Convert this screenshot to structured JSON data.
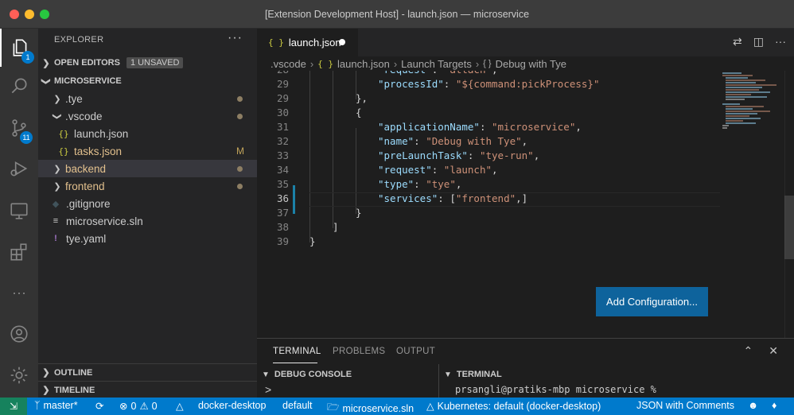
{
  "window": {
    "title": "[Extension Development Host] - launch.json — microservice"
  },
  "activity_bar": {
    "explorer_badge": "1",
    "scm_badge": "11",
    "more": "···"
  },
  "sidebar": {
    "title": "EXPLORER",
    "more": "···",
    "open_editors": {
      "label": "OPEN EDITORS",
      "badge": "1 UNSAVED"
    },
    "folder": {
      "label": "MICROSERVICE"
    },
    "items": [
      {
        "label": ".tye",
        "icon": "chevron-right"
      },
      {
        "label": ".vscode",
        "icon": "chevron-down"
      },
      {
        "label": "launch.json",
        "icon": "json-braces"
      },
      {
        "label": "tasks.json",
        "icon": "json-braces",
        "status": "M"
      },
      {
        "label": "backend",
        "icon": "chevron-right"
      },
      {
        "label": "frontend",
        "icon": "chevron-right"
      },
      {
        "label": ".gitignore",
        "icon": "git-diamond"
      },
      {
        "label": "microservice.sln",
        "icon": "lines"
      },
      {
        "label": "tye.yaml",
        "icon": "exclamation"
      }
    ],
    "outline": "OUTLINE",
    "timeline": "TIMELINE"
  },
  "editor": {
    "tab": {
      "label": "launch.json",
      "icon_text": "{ }"
    },
    "breadcrumbs": [
      ".vscode",
      "launch.json",
      "Launch Targets",
      "Debug with Tye"
    ],
    "breadcrumb_icons": {
      "json": "{ }",
      "object": "{ }"
    },
    "lines": [
      {
        "num": "28",
        "parts": [
          {
            "t": "k",
            "v": "\"request\""
          },
          {
            "t": "p",
            "v": ": "
          },
          {
            "t": "s",
            "v": "\"attach\""
          },
          {
            "t": "p",
            "v": ","
          }
        ]
      },
      {
        "num": "29",
        "parts": [
          {
            "t": "k",
            "v": "\"processId\""
          },
          {
            "t": "p",
            "v": ": "
          },
          {
            "t": "s",
            "v": "\"${command:pickProcess}\""
          }
        ]
      },
      {
        "num": "29",
        "parts": [
          {
            "t": "p",
            "v": "},"
          }
        ]
      },
      {
        "num": "30",
        "parts": [
          {
            "t": "p",
            "v": "{"
          }
        ]
      },
      {
        "num": "31",
        "parts": [
          {
            "t": "k",
            "v": "\"applicationName\""
          },
          {
            "t": "p",
            "v": ": "
          },
          {
            "t": "s",
            "v": "\"microservice\""
          },
          {
            "t": "p",
            "v": ","
          }
        ]
      },
      {
        "num": "32",
        "parts": [
          {
            "t": "k",
            "v": "\"name\""
          },
          {
            "t": "p",
            "v": ": "
          },
          {
            "t": "s",
            "v": "\"Debug with Tye\""
          },
          {
            "t": "p",
            "v": ","
          }
        ]
      },
      {
        "num": "33",
        "parts": [
          {
            "t": "k",
            "v": "\"preLaunchTask\""
          },
          {
            "t": "p",
            "v": ": "
          },
          {
            "t": "s",
            "v": "\"tye-run\""
          },
          {
            "t": "p",
            "v": ","
          }
        ]
      },
      {
        "num": "34",
        "parts": [
          {
            "t": "k",
            "v": "\"request\""
          },
          {
            "t": "p",
            "v": ": "
          },
          {
            "t": "s",
            "v": "\"launch\""
          },
          {
            "t": "p",
            "v": ","
          }
        ]
      },
      {
        "num": "35",
        "parts": [
          {
            "t": "k",
            "v": "\"type\""
          },
          {
            "t": "p",
            "v": ": "
          },
          {
            "t": "s",
            "v": "\"tye\""
          },
          {
            "t": "p",
            "v": ","
          }
        ]
      },
      {
        "num": "36",
        "parts": [
          {
            "t": "k",
            "v": "\"services\""
          },
          {
            "t": "p",
            "v": ": "
          },
          {
            "t": "p",
            "v": "["
          },
          {
            "t": "s",
            "v": "\"frontend\""
          },
          {
            "t": "p",
            "v": ",]"
          }
        ]
      },
      {
        "num": "37",
        "parts": [
          {
            "t": "p",
            "v": "}"
          }
        ]
      },
      {
        "num": "38",
        "parts": [
          {
            "t": "p",
            "v": "]"
          }
        ]
      },
      {
        "num": "39",
        "parts": [
          {
            "t": "p",
            "v": "}"
          }
        ]
      }
    ],
    "add_configuration": "Add Configuration..."
  },
  "panel": {
    "tabs": [
      "TERMINAL",
      "PROBLEMS",
      "OUTPUT"
    ],
    "debug_console": "DEBUG CONSOLE",
    "terminal": "TERMINAL",
    "prompt_symbol": ">",
    "terminal_line": "prsangli@pratiks-mbp microservice %"
  },
  "status_bar": {
    "branch": "master*",
    "errors": "0",
    "warnings": "0",
    "context": "docker-desktop",
    "namespace": "default",
    "solution": "microservice.sln",
    "kubernetes": "Kubernetes: default (docker-desktop)",
    "language": "JSON with Comments"
  }
}
